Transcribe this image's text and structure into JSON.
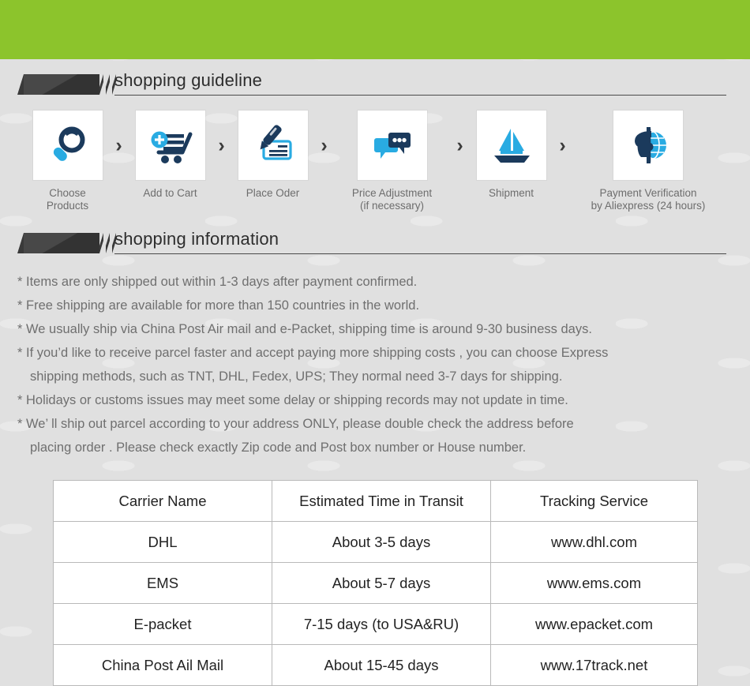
{
  "theme": {
    "banner_green": "#8cc42c",
    "page_background": "#e0e0e0",
    "heading_tag": "#3a3a3a",
    "icon_dark_blue": "#1b3a5c",
    "icon_light_blue": "#29abe2",
    "body_text": "#6f6f6f",
    "table_text": "#232323",
    "table_border": "#b9b9b9"
  },
  "sections": {
    "guideline": {
      "title": "shopping guideline"
    },
    "information": {
      "title": "shopping information"
    }
  },
  "steps": [
    {
      "icon": "magnifier-icon",
      "label": "Choose Products"
    },
    {
      "separator": "chevron-right-icon"
    },
    {
      "icon": "add-to-cart-icon",
      "label": "Add to Cart"
    },
    {
      "separator": "chevron-right-icon"
    },
    {
      "icon": "pen-check-icon",
      "label": "Place Oder"
    },
    {
      "separator": "chevron-right-icon"
    },
    {
      "icon": "chat-bubbles-icon",
      "label": "Price Adjustment\n(if necessary)"
    },
    {
      "separator": "chevron-right-icon"
    },
    {
      "icon": "sailboat-icon",
      "label": "Shipment"
    },
    {
      "separator": "chevron-right-icon"
    },
    {
      "icon": "dollar-globe-icon",
      "label": "Payment Verification\nby  Aliexpress (24 hours)"
    }
  ],
  "step_labels": {
    "s1": "Choose Products",
    "s2": "Add to Cart",
    "s3": "Place Oder",
    "s4": "Price Adjustment\n(if necessary)",
    "s5": "Shipment",
    "s6": "Payment Verification\nby  Aliexpress (24 hours)",
    "chevron": "›"
  },
  "info_lines": [
    {
      "text": "* Items are only shipped out within 1-3 days after payment confirmed.",
      "indent": false
    },
    {
      "text": "* Free shipping are available for more than 150 countries in the world.",
      "indent": false
    },
    {
      "text": "* We usually ship via China Post Air mail and e-Packet, shipping time is around 9-30 business days.",
      "indent": false
    },
    {
      "text": "* If you’d like to receive parcel faster and accept paying more shipping costs , you can choose Express",
      "indent": false
    },
    {
      "text": "shipping methods, such as TNT, DHL, Fedex, UPS; They normal need 3-7 days for shipping.",
      "indent": true
    },
    {
      "text": "* Holidays or customs issues may meet some delay or shipping records may not update in time.",
      "indent": false
    },
    {
      "text": "* We’ ll ship out parcel according to your address ONLY, please double check the address before",
      "indent": false
    },
    {
      "text": "placing order . Please check exactly Zip code and Post box number or House number.",
      "indent": true
    }
  ],
  "carrier_table": {
    "headers": [
      "Carrier Name",
      "Estimated Time in Transit",
      "Tracking Service"
    ],
    "rows": [
      [
        "DHL",
        "About 3-5 days",
        "www.dhl.com"
      ],
      [
        "EMS",
        "About 5-7 days",
        "www.ems.com"
      ],
      [
        "E-packet",
        "7-15 days (to USA&RU)",
        "www.epacket.com"
      ],
      [
        "China Post Ail Mail",
        "About 15-45 days",
        "www.17track.net"
      ]
    ]
  }
}
